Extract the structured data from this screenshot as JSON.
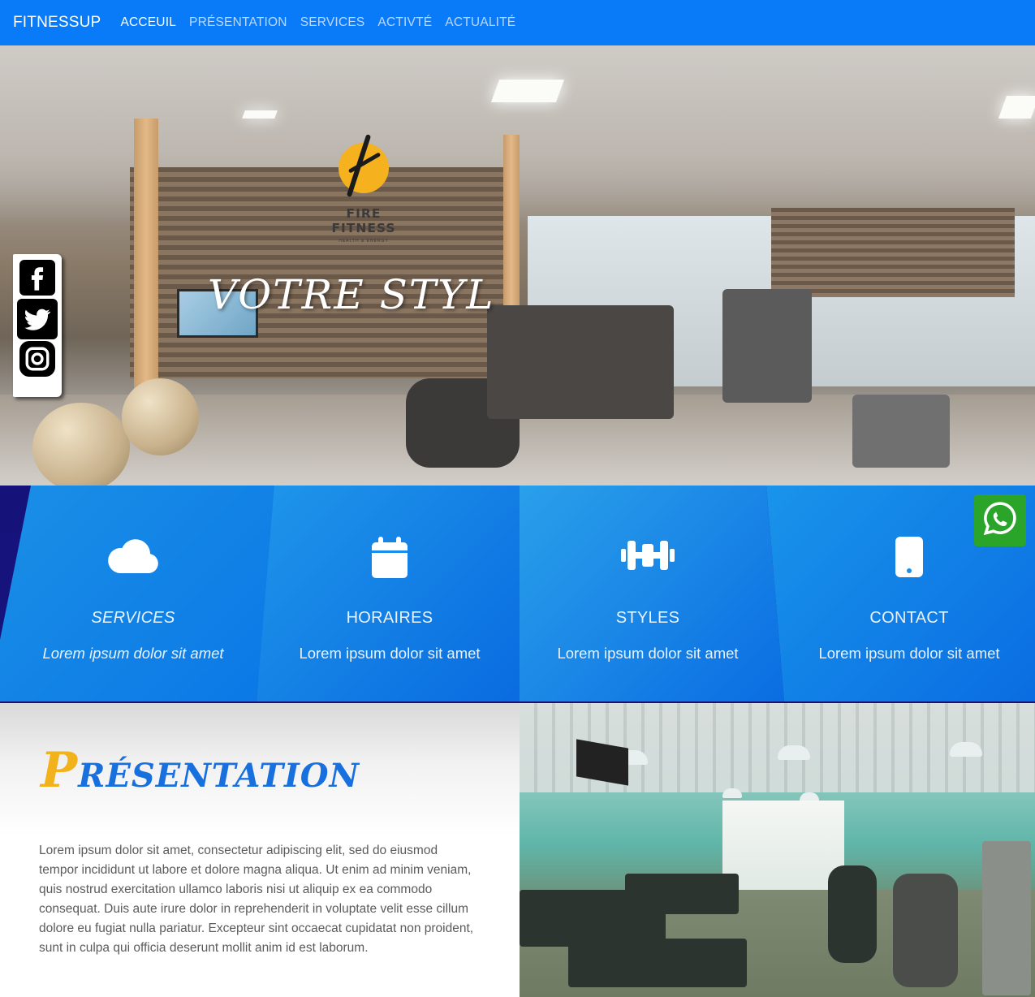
{
  "navbar": {
    "brand": "FITNESSUP",
    "items": [
      {
        "label": "ACCEUIL",
        "active": true
      },
      {
        "label": "PRÉSENTATION",
        "active": false
      },
      {
        "label": "SERVICES",
        "active": false
      },
      {
        "label": "ACTIVTÉ",
        "active": false
      },
      {
        "label": "ACTUALITÉ",
        "active": false
      }
    ]
  },
  "hero": {
    "title": "VOTRE STYL",
    "logo_text": "FIRE FITNESS",
    "logo_sub": "HEALTH & ENERGY"
  },
  "social": {
    "icons": [
      "facebook-icon",
      "twitter-icon",
      "instagram-icon"
    ]
  },
  "features": [
    {
      "icon": "cloud-icon",
      "title": "SERVICES",
      "desc": "Lorem ipsum dolor sit amet"
    },
    {
      "icon": "calendar-icon",
      "title": "HORAIRES",
      "desc": "Lorem ipsum dolor sit amet"
    },
    {
      "icon": "dumbbell-icon",
      "title": "STYLES",
      "desc": "Lorem ipsum dolor sit amet"
    },
    {
      "icon": "phone-icon",
      "title": "CONTACT",
      "desc": "Lorem ipsum dolor sit amet"
    }
  ],
  "presentation": {
    "title_cap": "P",
    "title_rest": "RÉSENTATION",
    "text": "Lorem ipsum dolor sit amet, consectetur adipiscing elit, sed do eiusmod tempor incididunt ut labore et dolore magna aliqua. Ut enim ad minim veniam, quis nostrud exercitation ullamco laboris nisi ut aliquip ex ea commodo consequat. Duis aute irure dolor in reprehenderit in voluptate velit esse cillum dolore eu fugiat nulla pariatur. Excepteur sint occaecat cupidatat non proident, sunt in culpa qui officia deserunt mollit anim id est laborum."
  },
  "colors": {
    "navbar": "#0a7bf8",
    "accent_blue": "#1770de",
    "accent_yellow": "#f2b21b",
    "whatsapp": "#2aa52a",
    "band_dark": "#16147c"
  }
}
